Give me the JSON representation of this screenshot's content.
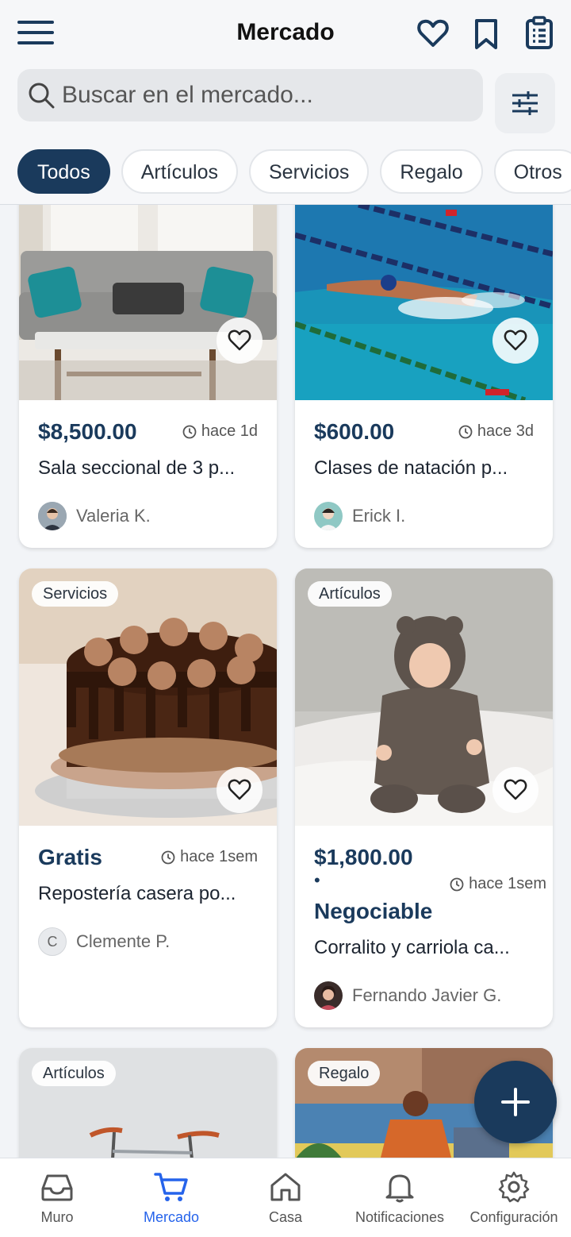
{
  "header": {
    "title": "Mercado",
    "search_placeholder": "Buscar en el mercado..."
  },
  "filters": [
    "Todos",
    "Artículos",
    "Servicios",
    "Regalo",
    "Otros"
  ],
  "active_filter": "Todos",
  "listings": [
    {
      "price": "$8,500.00",
      "time": "hace 1d",
      "title": "Sala seccional de 3 p...",
      "seller": "Valeria K.",
      "image": "sofa-photo"
    },
    {
      "price": "$600.00",
      "time": "hace 3d",
      "title": "Clases de natación p...",
      "seller": "Erick I.",
      "image": "swimmer-photo"
    },
    {
      "tag": "Servicios",
      "price": "Gratis",
      "time": "hace 1sem",
      "title": "Repostería casera po...",
      "seller": "Clemente P.",
      "avatar_initial": "C",
      "image": "cake-photo"
    },
    {
      "tag": "Artículos",
      "price": "$1,800.00",
      "price_bullet": "•",
      "price_note": "Negociable",
      "time": "hace 1sem",
      "title": "Corralito y carriola ca...",
      "seller": "Fernando Javier G.",
      "image": "baby-photo"
    },
    {
      "tag": "Artículos",
      "image": "bicycle-photo"
    },
    {
      "tag": "Regalo",
      "image": "mural-photo"
    }
  ],
  "tabs": [
    {
      "label": "Muro",
      "icon": "inbox-icon"
    },
    {
      "label": "Mercado",
      "icon": "cart-icon",
      "active": true
    },
    {
      "label": "Casa",
      "icon": "home-icon"
    },
    {
      "label": "Notificaciones",
      "icon": "bell-icon"
    },
    {
      "label": "Configuración",
      "icon": "gear-icon"
    }
  ],
  "colors": {
    "primary": "#1a3a5c",
    "active_tab": "#2563eb",
    "background": "#f2f4f7"
  }
}
